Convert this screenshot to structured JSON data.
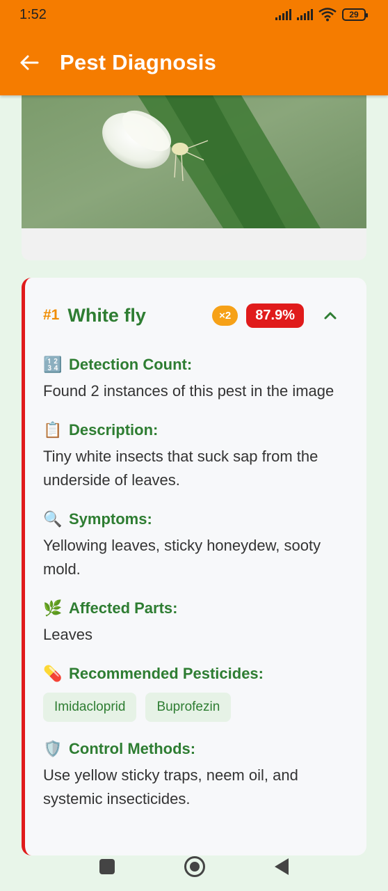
{
  "status_bar": {
    "time": "1:52",
    "battery": "29"
  },
  "toolbar": {
    "title": "Pest Diagnosis",
    "back_icon": "arrow-left-icon"
  },
  "result": {
    "rank": "#1",
    "name": "White fly",
    "count_badge": "×2",
    "confidence": "87.9%",
    "accent_color": "#e01b1b",
    "sections": {
      "detection_count": {
        "title": "Detection Count:",
        "icon": "🔢",
        "text": "Found 2 instances of this pest in the image"
      },
      "description": {
        "title": "Description:",
        "icon": "📋",
        "text": "Tiny white insects that suck sap from the underside of leaves."
      },
      "symptoms": {
        "title": "Symptoms:",
        "icon": "🔍",
        "text": "Yellowing leaves, sticky honeydew, sooty mold."
      },
      "affected_parts": {
        "title": "Affected Parts:",
        "icon": "🌿",
        "text": "Leaves"
      },
      "pesticides": {
        "title": "Recommended Pesticides:",
        "icon": "💊",
        "items": [
          "Imidacloprid",
          "Buprofezin"
        ]
      },
      "control": {
        "title": "Control Methods:",
        "icon": "🛡️",
        "text": "Use yellow sticky traps, neem oil, and systemic insecticides."
      }
    }
  },
  "colors": {
    "app_bar": "#f57c00",
    "primary_green": "#2e7d32",
    "rank_orange": "#f08c00",
    "count_badge": "#f6a117"
  }
}
